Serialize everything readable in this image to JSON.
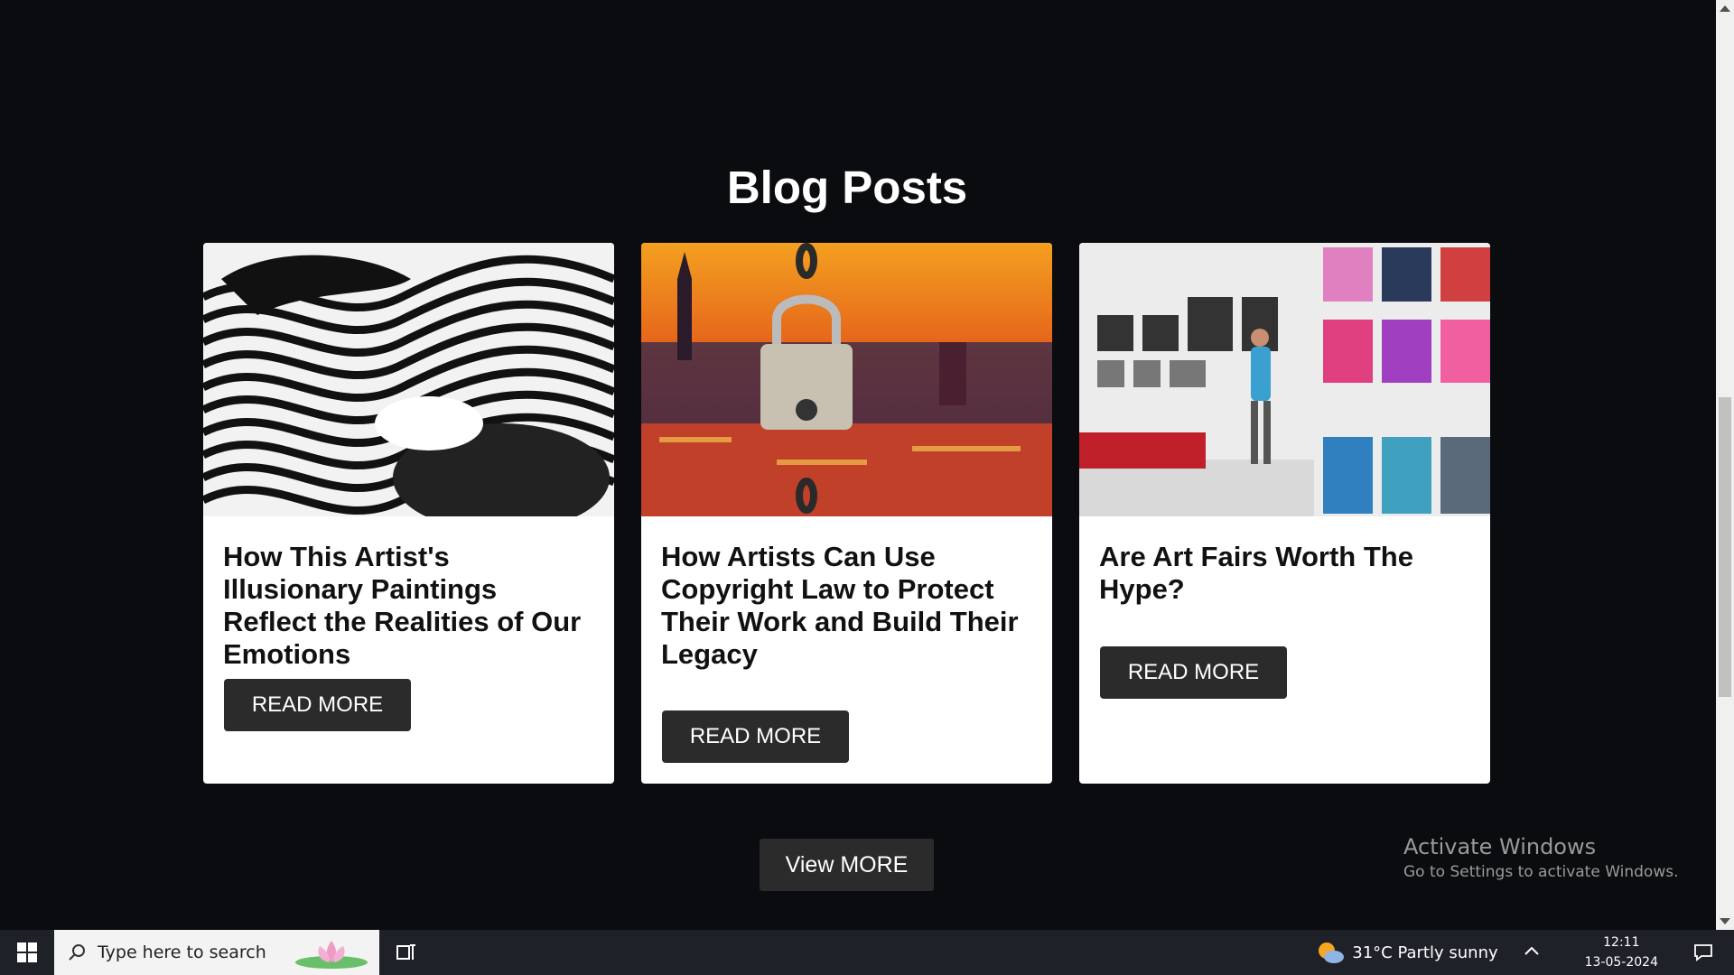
{
  "section": {
    "title": "Blog Posts"
  },
  "posts": [
    {
      "title": "How This Artist's Illusionary Paintings Reflect the Realities of Our Emotions",
      "button": "READ MORE",
      "image": "abstract-zebra-art"
    },
    {
      "title": "How Artists Can Use Copyright Law to Protect Their Work and Build Their Legacy",
      "button": "READ MORE",
      "image": "padlock-city-painting"
    },
    {
      "title": "Are Art Fairs Worth The Hype?",
      "button": "READ MORE",
      "image": "art-fair-gallery"
    }
  ],
  "view_more": "View MORE",
  "watermark": {
    "title": "Activate Windows",
    "subtitle": "Go to Settings to activate Windows."
  },
  "taskbar": {
    "search_placeholder": "Type here to search",
    "weather": "31°C  Partly sunny",
    "time": "12:11",
    "date": "13-05-2024"
  }
}
